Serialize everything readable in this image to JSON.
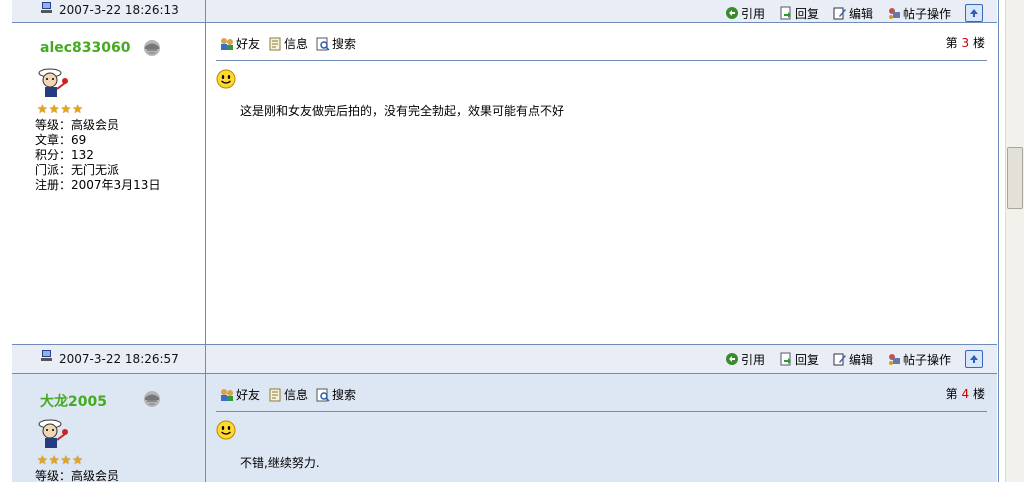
{
  "actions": {
    "quote": "引用",
    "reply": "回复",
    "edit": "编辑",
    "post_ops": "帖子操作"
  },
  "tools": {
    "friend": "好友",
    "info": "信息",
    "search": "搜索"
  },
  "top_bar": {
    "time": "2007-3-22 18:26:13"
  },
  "post1": {
    "username": "alec833060",
    "floor_prefix": "第",
    "floor_number": "3",
    "floor_suffix": "楼",
    "level": "等级：高级会员",
    "posts": "文章：69",
    "points": "积分：132",
    "faction": "门派：无门无派",
    "registered": "注册：2007年3月13日",
    "star_rating": 4,
    "content": "这是刚和女友做完后拍的，没有完全勃起，效果可能有点不好"
  },
  "mid_bar": {
    "time": "2007-3-22 18:26:57"
  },
  "post2": {
    "username": "大龙2005",
    "floor_prefix": "第",
    "floor_number": "4",
    "floor_suffix": "楼",
    "level": "等级：高级会员",
    "star_rating": 4,
    "content": "不错,继续努力."
  },
  "colors": {
    "border": "#6f8cb9",
    "bar_bg": "#e9eef6",
    "alt_post_bg": "#dde6f3",
    "username": "#44aa22",
    "floor_number": "#cc0000"
  }
}
